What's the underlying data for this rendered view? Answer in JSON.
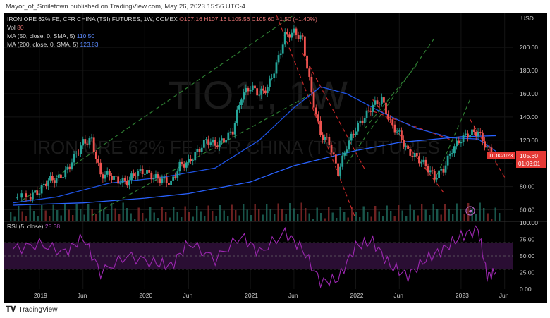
{
  "header": {
    "publisher_line": "Mayor_of_Smiletown published on TradingView.com, May 26, 2023 15:56 UTC-4"
  },
  "legend": {
    "symbol": "IRON ORE 62% FE, CFR CHINA (TSI) FUTURES, 1W, COMEX",
    "ohlc_o": "O107.16",
    "ohlc_h": "H107.16",
    "ohlc_l": "L105.56",
    "ohlc_c": "C105.60",
    "change": "−1.50 (−1.40%)",
    "vol_label": "Vol",
    "vol_value": "80",
    "ma50_label": "MA (50, close, 0, SMA, 5)",
    "ma50_value": "110.50",
    "ma200_label": "MA (200, close, 0, SMA, 5)",
    "ma200_value": "123.83",
    "rsi_label": "RSI (5, close)",
    "rsi_value": "25.38"
  },
  "watermark": {
    "ticker": "TIO1!, 1W",
    "name": "IRON ORE 62% FE, CFR CHINA (TSI) FUTURES"
  },
  "price_tag": {
    "ticker": "TIOK2023",
    "price": "105.60",
    "countdown": "01:03:01"
  },
  "currency": "USD",
  "footer": {
    "logo_text": "TradingView"
  },
  "colors": {
    "up": "#26a69a",
    "down": "#ef5350",
    "ma50": "#1e53e5",
    "ma200": "#2962ff",
    "rsi": "#9c27b0",
    "trend_green": "#2e7d32",
    "trend_red": "#c62828"
  },
  "chart_data": {
    "type": "candlestick",
    "price_axis": {
      "ticks": [
        60,
        80,
        100,
        120,
        140,
        160,
        180,
        200
      ],
      "labels": [
        "60.00",
        "80.00",
        "100.00",
        "120.00",
        "140.00",
        "160.00",
        "180.00",
        "200.00"
      ],
      "ylim": [
        50,
        225
      ]
    },
    "rsi_axis": {
      "ticks": [
        0,
        25,
        50,
        75,
        100
      ],
      "labels": [
        "0.00",
        "25.00",
        "50.00",
        "75.00",
        "100.00"
      ],
      "band": [
        30,
        70
      ]
    },
    "x_axis": {
      "labels": [
        "2019",
        "Jun",
        "2020",
        "Jun",
        "2021",
        "Jun",
        "2022",
        "Jun",
        "2023",
        "Jun"
      ],
      "dates": [
        "2019-01",
        "2019-06",
        "2020-01",
        "2020-06",
        "2021-01",
        "2021-06",
        "2022-01",
        "2022-06",
        "2023-01",
        "2023-06"
      ]
    },
    "price_series": [
      {
        "date": "2018-10",
        "close": 70
      },
      {
        "date": "2018-12",
        "close": 72
      },
      {
        "date": "2019-01",
        "close": 76
      },
      {
        "date": "2019-02",
        "close": 86
      },
      {
        "date": "2019-03",
        "close": 86
      },
      {
        "date": "2019-04",
        "close": 92
      },
      {
        "date": "2019-05",
        "close": 105
      },
      {
        "date": "2019-06",
        "close": 118
      },
      {
        "date": "2019-07",
        "close": 120
      },
      {
        "date": "2019-08",
        "close": 90
      },
      {
        "date": "2019-09",
        "close": 90
      },
      {
        "date": "2019-10",
        "close": 85
      },
      {
        "date": "2019-11",
        "close": 84
      },
      {
        "date": "2019-12",
        "close": 92
      },
      {
        "date": "2020-01",
        "close": 93
      },
      {
        "date": "2020-02",
        "close": 88
      },
      {
        "date": "2020-03",
        "close": 86
      },
      {
        "date": "2020-04",
        "close": 83
      },
      {
        "date": "2020-05",
        "close": 98
      },
      {
        "date": "2020-06",
        "close": 101
      },
      {
        "date": "2020-07",
        "close": 110
      },
      {
        "date": "2020-08",
        "close": 120
      },
      {
        "date": "2020-09",
        "close": 116
      },
      {
        "date": "2020-10",
        "close": 120
      },
      {
        "date": "2020-11",
        "close": 128
      },
      {
        "date": "2020-12",
        "close": 158
      },
      {
        "date": "2021-01",
        "close": 166
      },
      {
        "date": "2021-02",
        "close": 160
      },
      {
        "date": "2021-03",
        "close": 165
      },
      {
        "date": "2021-04",
        "close": 185
      },
      {
        "date": "2021-05",
        "close": 210
      },
      {
        "date": "2021-06",
        "close": 213
      },
      {
        "date": "2021-07",
        "close": 207
      },
      {
        "date": "2021-08",
        "close": 160
      },
      {
        "date": "2021-09",
        "close": 125
      },
      {
        "date": "2021-10",
        "close": 118
      },
      {
        "date": "2021-11",
        "close": 92
      },
      {
        "date": "2021-12",
        "close": 115
      },
      {
        "date": "2022-01",
        "close": 130
      },
      {
        "date": "2022-02",
        "close": 140
      },
      {
        "date": "2022-03",
        "close": 150
      },
      {
        "date": "2022-04",
        "close": 155
      },
      {
        "date": "2022-05",
        "close": 135
      },
      {
        "date": "2022-06",
        "close": 125
      },
      {
        "date": "2022-07",
        "close": 110
      },
      {
        "date": "2022-08",
        "close": 105
      },
      {
        "date": "2022-09",
        "close": 98
      },
      {
        "date": "2022-10",
        "close": 88
      },
      {
        "date": "2022-11",
        "close": 95
      },
      {
        "date": "2022-12",
        "close": 112
      },
      {
        "date": "2023-01",
        "close": 121
      },
      {
        "date": "2023-02",
        "close": 126
      },
      {
        "date": "2023-03",
        "close": 127
      },
      {
        "date": "2023-04",
        "close": 113
      },
      {
        "date": "2023-05",
        "close": 105.6
      }
    ],
    "ma50": [
      {
        "date": "2018-10",
        "value": 66
      },
      {
        "date": "2019-03",
        "value": 71
      },
      {
        "date": "2019-09",
        "value": 83
      },
      {
        "date": "2020-03",
        "value": 88
      },
      {
        "date": "2020-09",
        "value": 96
      },
      {
        "date": "2021-02",
        "value": 120
      },
      {
        "date": "2021-06",
        "value": 148
      },
      {
        "date": "2021-09",
        "value": 166
      },
      {
        "date": "2021-12",
        "value": 160
      },
      {
        "date": "2022-04",
        "value": 144
      },
      {
        "date": "2022-08",
        "value": 130
      },
      {
        "date": "2022-12",
        "value": 122
      },
      {
        "date": "2023-03",
        "value": 121
      },
      {
        "date": "2023-05",
        "value": 110.5
      }
    ],
    "ma200": [
      {
        "date": "2018-10",
        "value": 64
      },
      {
        "date": "2019-06",
        "value": 66
      },
      {
        "date": "2020-01",
        "value": 70
      },
      {
        "date": "2020-06",
        "value": 74
      },
      {
        "date": "2021-01",
        "value": 84
      },
      {
        "date": "2021-06",
        "value": 98
      },
      {
        "date": "2022-01",
        "value": 111
      },
      {
        "date": "2022-06",
        "value": 118
      },
      {
        "date": "2023-01",
        "value": 123
      },
      {
        "date": "2023-05",
        "value": 123.83
      }
    ],
    "rsi": [
      {
        "date": "2018-10",
        "value": 60
      },
      {
        "date": "2019-01",
        "value": 68
      },
      {
        "date": "2019-04",
        "value": 55
      },
      {
        "date": "2019-06",
        "value": 78
      },
      {
        "date": "2019-08",
        "value": 25
      },
      {
        "date": "2019-11",
        "value": 50
      },
      {
        "date": "2020-02",
        "value": 40
      },
      {
        "date": "2020-04",
        "value": 35
      },
      {
        "date": "2020-06",
        "value": 70
      },
      {
        "date": "2020-09",
        "value": 45
      },
      {
        "date": "2020-12",
        "value": 80
      },
      {
        "date": "2021-02",
        "value": 55
      },
      {
        "date": "2021-05",
        "value": 85
      },
      {
        "date": "2021-07",
        "value": 60
      },
      {
        "date": "2021-09",
        "value": 10
      },
      {
        "date": "2021-11",
        "value": 15
      },
      {
        "date": "2022-01",
        "value": 65
      },
      {
        "date": "2022-03",
        "value": 72
      },
      {
        "date": "2022-05",
        "value": 35
      },
      {
        "date": "2022-07",
        "value": 20
      },
      {
        "date": "2022-09",
        "value": 45
      },
      {
        "date": "2022-11",
        "value": 60
      },
      {
        "date": "2023-01",
        "value": 80
      },
      {
        "date": "2023-03",
        "value": 90
      },
      {
        "date": "2023-04",
        "value": 20
      },
      {
        "date": "2023-05",
        "value": 25.38
      }
    ],
    "trend_lines": [
      {
        "color": "green",
        "from": {
          "date": "2018-11",
          "value": 68
        },
        "to": {
          "date": "2021-06",
          "value": 228
        }
      },
      {
        "color": "green",
        "from": {
          "date": "2019-07",
          "value": 55
        },
        "to": {
          "date": "2021-08",
          "value": 160
        }
      },
      {
        "color": "green",
        "from": {
          "date": "2021-12",
          "value": 100
        },
        "to": {
          "date": "2022-10",
          "value": 208
        }
      },
      {
        "color": "green",
        "from": {
          "date": "2022-02",
          "value": 130
        },
        "to": {
          "date": "2022-08",
          "value": 185
        }
      },
      {
        "color": "green",
        "from": {
          "date": "2022-10",
          "value": 85
        },
        "to": {
          "date": "2023-02",
          "value": 155
        }
      },
      {
        "color": "red",
        "from": {
          "date": "2021-04",
          "value": 228
        },
        "to": {
          "date": "2022-01",
          "value": 52
        }
      },
      {
        "color": "red",
        "from": {
          "date": "2021-07",
          "value": 195
        },
        "to": {
          "date": "2022-02",
          "value": 95
        }
      },
      {
        "color": "red",
        "from": {
          "date": "2022-03",
          "value": 155
        },
        "to": {
          "date": "2022-11",
          "value": 75
        }
      },
      {
        "color": "red",
        "from": {
          "date": "2022-03",
          "value": 145
        },
        "to": {
          "date": "2022-12",
          "value": 120
        }
      },
      {
        "color": "red",
        "from": {
          "date": "2023-02",
          "value": 138
        },
        "to": {
          "date": "2023-06",
          "value": 88
        }
      }
    ]
  }
}
